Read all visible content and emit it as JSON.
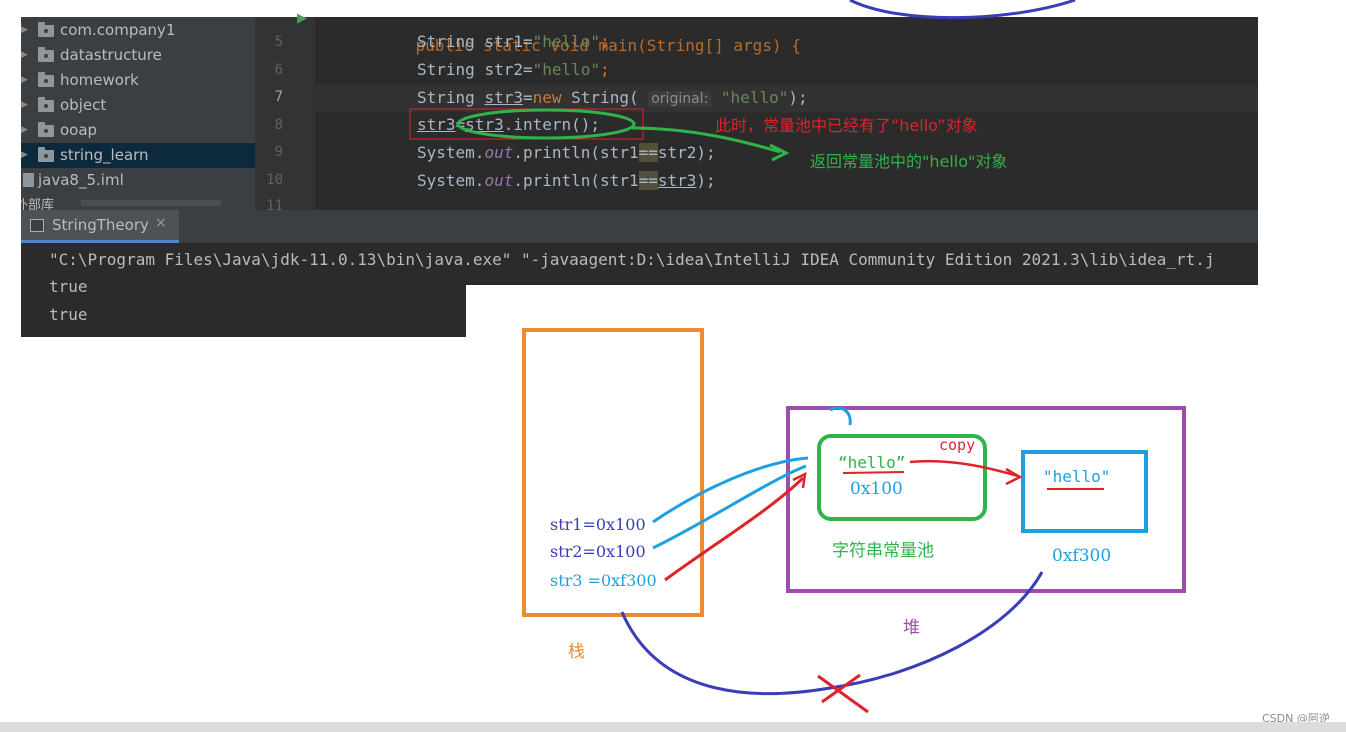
{
  "project_tree": {
    "items": [
      {
        "label": "com.company1",
        "type": "folder"
      },
      {
        "label": "datastructure",
        "type": "folder"
      },
      {
        "label": "homework",
        "type": "folder"
      },
      {
        "label": "object",
        "type": "folder"
      },
      {
        "label": "ooap",
        "type": "folder"
      },
      {
        "label": "string_learn",
        "type": "folder",
        "selected": true
      },
      {
        "label": "java8_5.iml",
        "type": "file"
      }
    ],
    "external_libs": "外部库"
  },
  "editor": {
    "line_numbers": [
      "5",
      "6",
      "7",
      "8",
      "9",
      "10",
      "11"
    ],
    "line_top_partial": "public static void main(String[] args) {",
    "str_type": "String",
    "var1": "str1",
    "var2": "str2",
    "var3": "str3",
    "str_literal": "\"hello\"",
    "eq": "=",
    "semi": ";",
    "new_kw": "new",
    "string_ctor": "String(",
    "param_hint": "original:",
    "close_paren": ");",
    "intern_call": ".intern();",
    "system": "System.",
    "out": "out",
    "println": ".println(",
    "eqeq": "=="
  },
  "run_panel": {
    "tab_label": "StringTheory",
    "tab_close": "×",
    "console_lines": [
      "\"C:\\Program Files\\Java\\jdk-11.0.13\\bin\\java.exe\" \"-javaagent:D:\\idea\\IntelliJ IDEA Community Edition 2021.3\\lib\\idea_rt.j",
      "true",
      "true"
    ]
  },
  "annotations": {
    "note_red": "此时，常量池中已经有了“hello”对象",
    "note_green": "返回常量池中的\"hello\"对象",
    "stack_vars": [
      "str1=0x100",
      "str2=0x100",
      "str3 =0xf300"
    ],
    "stack_label": "栈",
    "heap_label": "堆",
    "pool_literal": "“hello”",
    "pool_addr": "0x100",
    "pool_label": "字符串常量池",
    "copy_label": "copy",
    "heap_obj_literal": "\"hello\"",
    "heap_obj_addr": "0xf300",
    "colors": {
      "orange": "#f08a32",
      "purple": "#9b4fa8",
      "green": "#2fb34a",
      "blue": "#1ea0e0",
      "red": "#e0222a",
      "darkblue": "#3a3db8"
    }
  },
  "watermark": "CSDN @阿逆"
}
